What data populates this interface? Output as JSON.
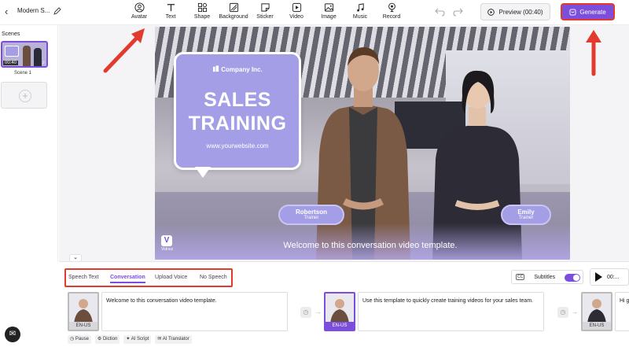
{
  "header": {
    "project_title": "Modern S...",
    "tools": [
      {
        "label": "Avatar",
        "icon": "avatar-icon"
      },
      {
        "label": "Text",
        "icon": "text-icon"
      },
      {
        "label": "Shape",
        "icon": "shape-icon"
      },
      {
        "label": "Background",
        "icon": "background-icon"
      },
      {
        "label": "Sticker",
        "icon": "sticker-icon"
      },
      {
        "label": "Video",
        "icon": "video-icon"
      },
      {
        "label": "Image",
        "icon": "image-icon"
      },
      {
        "label": "Music",
        "icon": "music-icon"
      },
      {
        "label": "Record",
        "icon": "record-icon"
      }
    ],
    "preview_label": "Preview (00:40)",
    "generate_label": "Generate"
  },
  "scenes": {
    "title": "Scenes",
    "items": [
      {
        "name": "Scene 1",
        "duration": "00:40"
      }
    ]
  },
  "canvas": {
    "company": "Company Inc.",
    "headline_line1": "SALES",
    "headline_line2": "TRAINING",
    "website": "www.yourwebsite.com",
    "presenters": [
      {
        "name": "Robertson",
        "role": "Trainer"
      },
      {
        "name": "Emily",
        "role": "Trainer"
      }
    ],
    "logo_text": "Vidnoz",
    "caption": "Welcome to this conversation video template."
  },
  "speech_tabs": {
    "items": [
      "Speech Text",
      "Conversation",
      "Upload Voice",
      "No Speech"
    ],
    "active": "Conversation"
  },
  "subtitles": {
    "label": "Subtitles",
    "cc": "CC",
    "enabled": true
  },
  "player": {
    "time": "00:..."
  },
  "segments": [
    {
      "lang": "EN-US",
      "text": "Welcome to this conversation video template."
    },
    {
      "lang": "EN-US",
      "text": "Use this template to quickly create training videos for your sales team."
    },
    {
      "lang": "EN-US",
      "text": "Hi g..."
    }
  ],
  "speech_tools": [
    "Pause",
    "Diction",
    "AI Script",
    "AI Translator"
  ],
  "colors": {
    "accent": "#7b4fdc",
    "annotation": "#e23b2e",
    "card": "#a39ee6"
  }
}
